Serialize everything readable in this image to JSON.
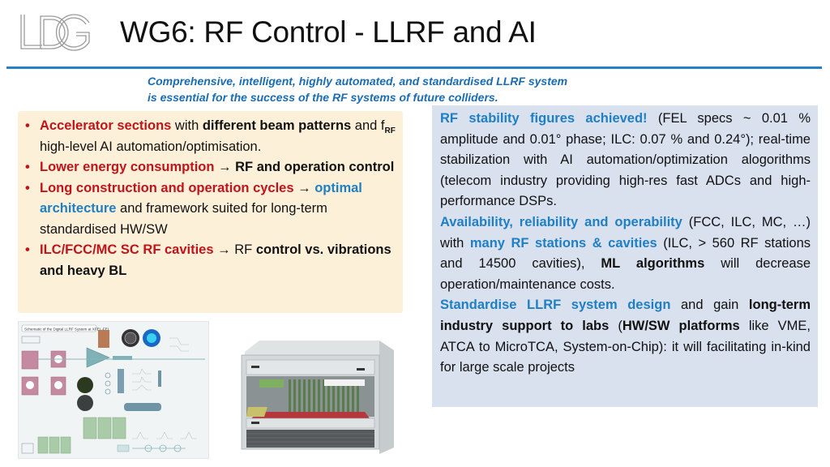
{
  "header": {
    "logo_text": "LDG",
    "title": "WG6: RF Control - LLRF and AI"
  },
  "subtitle": {
    "line1": "Comprehensive, intelligent, highly automated, and standardised LLRF system",
    "line2": "is essential for the success of the RF systems of future colliders."
  },
  "colors": {
    "accent_blue": "#1f7fc3",
    "highlight_red": "#c0141b",
    "left_box_bg": "#fdf0d9",
    "right_box_bg": "#d9e1ef",
    "rule": "#2c7fc0"
  },
  "left_box": {
    "bullets": [
      {
        "red": "Accelerator sections",
        "t1": " with ",
        "bold": "different beam patterns",
        "t2": " and f",
        "sub": "RF",
        "t3": " high-level AI automation/optimisation."
      },
      {
        "red": "Lower energy consumption",
        "arrow": " → ",
        "bold": "RF and operation control"
      },
      {
        "red": "Long construction and operation cycles",
        "arrow": " → ",
        "blue": "optimal architecture",
        "t1": " and framework suited for long-term standardised HW/SW"
      },
      {
        "red": "ILC/FCC/MC SC RF cavities",
        "arrow": " → ",
        "t1": "RF ",
        "bold": "control vs. vibrations and heavy BL"
      }
    ]
  },
  "right_box": {
    "p1": {
      "blue": "RF stability figures achieved!",
      "text": " (FEL specs ~ 0.01 % amplitude and 0.01° phase; ILC: 0.07 % and 0.24°); real-time stabilization with AI automation/optimization alogorithms (telecom industry providing high-res fast ADCs and high-performance DSPs."
    },
    "p2": {
      "blue1": "Availability, reliability and operability",
      "t1": " (FCC, ILC, MC, …) with ",
      "blue2": "many RF stations & cavities",
      "t2": " (ILC, > 560 RF stations and 14500 cavities), ",
      "bold": "ML algorithms",
      "t3": " will decrease operation/maintenance costs."
    },
    "p3": {
      "blue": "Standardise LLRF system design",
      "t1": " and gain ",
      "bold1": "long-term industry support to labs",
      "t2": " (",
      "bold2": "HW/SW platforms",
      "t3": " like VME, ATCA to MicroTCA, System-on-Chip): it will facilitating in-kind for large scale projects"
    }
  },
  "images": {
    "schematic_caption": "Schematic of the Digital LLRF System at XFEL-FEL",
    "crate_alt": "MicroTCA crate chassis"
  }
}
